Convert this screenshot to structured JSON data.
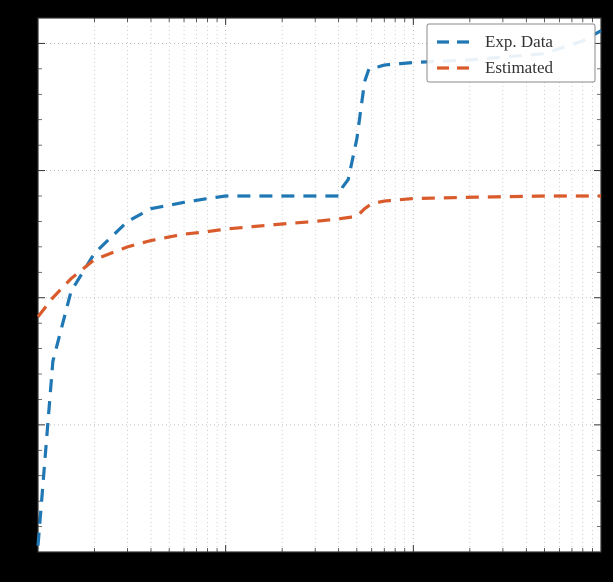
{
  "chart_data": {
    "type": "line",
    "xlabel": "",
    "ylabel": "",
    "title": "",
    "x_scale": "log",
    "xlim": [
      1,
      1000
    ],
    "ylim": [
      0,
      4.2
    ],
    "x_ticks": [
      1,
      10,
      100,
      1000
    ],
    "y_ticks": [
      0,
      1,
      2,
      3,
      4
    ],
    "x_tick_labels": [
      "",
      "",
      "",
      ""
    ],
    "y_tick_labels": [
      "",
      "",
      "",
      "",
      ""
    ],
    "grid": {
      "x": "minor_log",
      "y": "major"
    },
    "legend": {
      "position": "upper right"
    },
    "series": [
      {
        "name": "Exp. Data",
        "color": "#1f77b4",
        "style": "dashed",
        "x": [
          1,
          1.2,
          1.5,
          2,
          3,
          4,
          6,
          8,
          10,
          20,
          30,
          40,
          42,
          45,
          50,
          55,
          58,
          60,
          70,
          100,
          200,
          500,
          800,
          1000
        ],
        "y": [
          0.05,
          1.5,
          2.05,
          2.35,
          2.6,
          2.7,
          2.75,
          2.78,
          2.8,
          2.8,
          2.8,
          2.8,
          2.87,
          2.93,
          3.25,
          3.7,
          3.8,
          3.8,
          3.83,
          3.85,
          3.87,
          3.92,
          4.02,
          4.1
        ]
      },
      {
        "name": "Estimated",
        "color": "#d95b2b",
        "style": "dashed",
        "x": [
          1,
          1.2,
          1.5,
          2,
          3,
          4,
          6,
          8,
          10,
          20,
          30,
          40,
          50,
          55,
          60,
          70,
          100,
          200,
          500,
          1000
        ],
        "y": [
          1.85,
          2.0,
          2.15,
          2.3,
          2.4,
          2.45,
          2.5,
          2.52,
          2.54,
          2.58,
          2.6,
          2.62,
          2.64,
          2.7,
          2.74,
          2.76,
          2.78,
          2.79,
          2.8,
          2.8
        ]
      }
    ]
  }
}
